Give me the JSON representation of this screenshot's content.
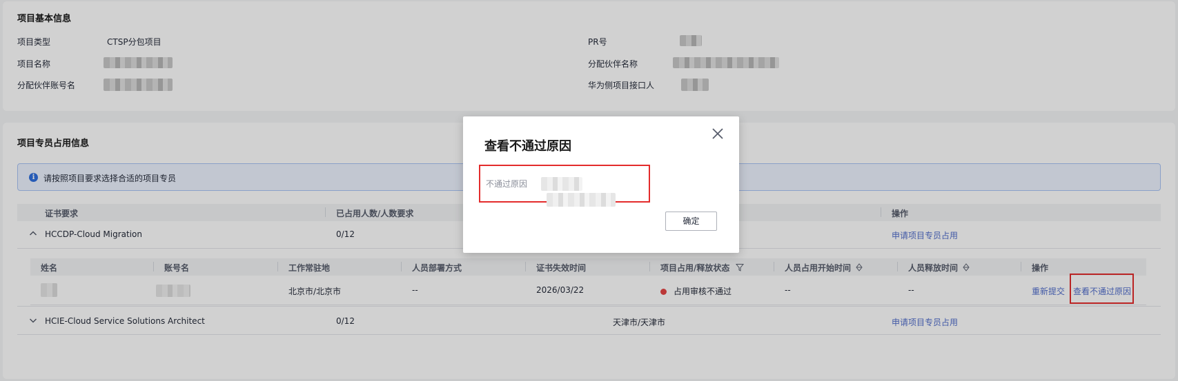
{
  "basic_info": {
    "title": "项目基本信息",
    "fields": [
      {
        "label": "项目类型",
        "value": "CTSP分包项目"
      },
      {
        "label": "项目名称",
        "value": ""
      },
      {
        "label": "分配伙伴账号名",
        "value": ""
      },
      {
        "label": "PR号",
        "value": ""
      },
      {
        "label": "分配伙伴名称",
        "value": ""
      },
      {
        "label": "华为侧项目接口人",
        "value": ""
      }
    ]
  },
  "occupy_info": {
    "title": "项目专员占用信息",
    "notice": "请按照项目要求选择合适的项目专员",
    "headers": {
      "cert_requirement": "证书要求",
      "occupied_count": "已占用人数/人数要求",
      "operation": "操作"
    },
    "groups": [
      {
        "cert": "HCCDP-Cloud Migration",
        "count": "0/12",
        "location": "",
        "action": "申请项目专员占用",
        "expanded": true
      },
      {
        "cert": "HCIE-Cloud Service Solutions Architect",
        "count": "0/12",
        "location": "天津市/天津市",
        "action": "申请项目专员占用",
        "expanded": false
      }
    ],
    "subtable": {
      "headers": [
        "姓名",
        "账号名",
        "工作常驻地",
        "人员部署方式",
        "证书失效时间",
        "项目占用/释放状态",
        "人员占用开始时间",
        "人员释放时间",
        "操作"
      ],
      "rows": [
        {
          "name": "",
          "account": "",
          "work_location": "北京市/北京市",
          "deploy_mode": "--",
          "cert_expiry": "2026/03/22",
          "status": "占用审核不通过",
          "status_color": "#e54545",
          "occupy_start": "--",
          "release_time": "--",
          "actions": [
            "重新提交",
            "查看不通过原因"
          ]
        }
      ]
    }
  },
  "modal": {
    "title": "查看不通过原因",
    "field_label": "不通过原因",
    "confirm_label": "确定",
    "close_icon": "close-icon"
  },
  "colors": {
    "link": "#526ecc",
    "highlight_border": "#e32b2b",
    "notice_bg": "#edf3ff",
    "notice_icon": "#2f6fde"
  }
}
